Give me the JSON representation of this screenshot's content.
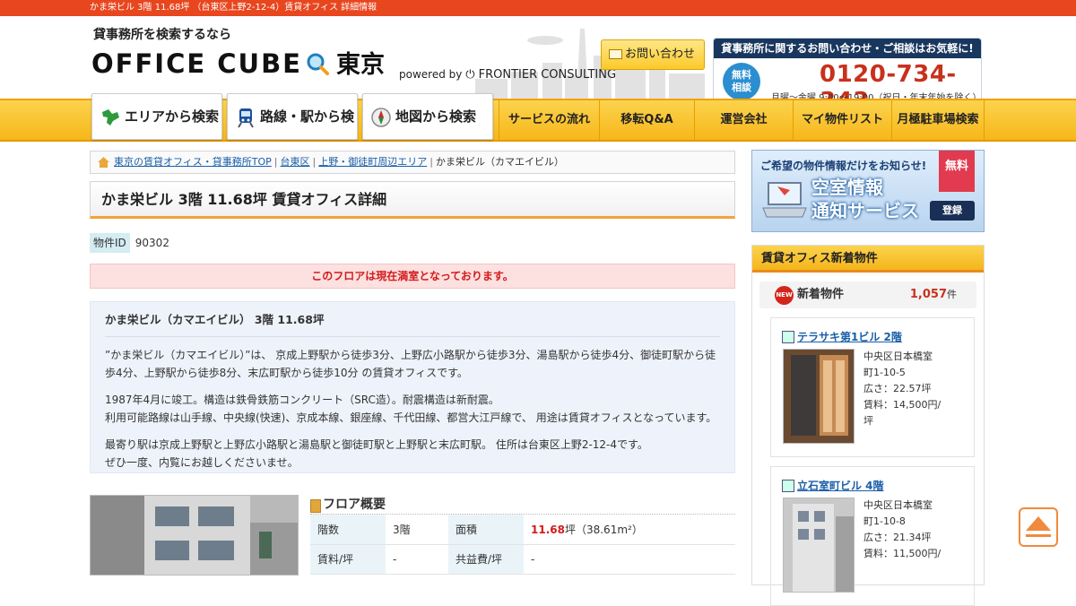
{
  "topbar": {
    "text": "かま栄ビル 3階 11.68坪 （台東区上野2-12-4）賃貸オフィス 詳細情報"
  },
  "header": {
    "tagline": "貸事務所を検索するなら",
    "logo_main": "OFFICE CUBE",
    "logo_city": "東京",
    "powered_by": "powered by",
    "company": "FRONTIER CONSULTING",
    "inquiry_button": "お問い合わせ",
    "contact_heading": "貸事務所に関するお問い合わせ・ご相談はお気軽に!",
    "free_badge_line1": "無料",
    "free_badge_line2": "相談",
    "phone": "0120-734-343",
    "hours": "月曜〜金曜 9:00〜19:00（祝日・年末年始を除く）"
  },
  "nav": {
    "area": "エリアから検索",
    "route": "路線・駅から検索",
    "map": "地図から検索",
    "items": [
      "サービスの流れ",
      "移転Q&A",
      "運営会社",
      "マイ物件リスト",
      "月極駐車場検索"
    ]
  },
  "breadcrumb": {
    "items": [
      "東京の賃貸オフィス・貸事務所TOP",
      "台東区",
      "上野・御徒町周辺エリア"
    ],
    "current": "かま栄ビル（カマエイビル）"
  },
  "main": {
    "title": "かま栄ビル 3階 11.68坪 賃貸オフィス詳細",
    "property_id_label": "物件ID",
    "property_id": "90302",
    "full_notice": "このフロアは現在満室となっております。",
    "desc_title": "かま栄ビル（カマエイビル） 3階 11.68坪",
    "desc_p1": "”かま栄ビル（カマエイビル）”は、 京成上野駅から徒歩3分、上野広小路駅から徒歩3分、湯島駅から徒歩4分、御徒町駅から徒歩4分、上野駅から徒歩8分、末広町駅から徒歩10分 の賃貸オフィスです。",
    "desc_p2a": "1987年4月に竣工。構造は鉄骨鉄筋コンクリート（SRC造）。耐震構造は新耐震。",
    "desc_p2b": "利用可能路線は山手線、中央線(快速)、京成本線、銀座線、千代田線、都営大江戸線で、 用途は賃貸オフィスとなっています。",
    "desc_p3a": "最寄り駅は京成上野駅と上野広小路駅と湯島駅と御徒町駅と上野駅と末広町駅。 住所は台東区上野2-12-4です。",
    "desc_p3b": "ぜひ一度、内覧にお越しくださいませ。"
  },
  "floor": {
    "heading": "フロア概要",
    "floors_label": "階数",
    "floors": "3階",
    "area_label": "面積",
    "area_tsubo": "11.68",
    "area_rest": "坪（38.61m²）",
    "rent_label": "賃料/坪",
    "rent": "-",
    "common_label": "共益費/坪",
    "common": "-"
  },
  "sidebar": {
    "banner_top": "ご希望の物件情報だけをお知らせ!",
    "banner_line1": "空室情報",
    "banner_line2": "通知サービス",
    "banner_free": "無料",
    "banner_login": "登録",
    "new_heading": "賃貸オフィス新着物件",
    "new_badge": "NEW",
    "new_label": "新着物件",
    "new_count": "1,057",
    "new_unit": "件",
    "cards": [
      {
        "title": "テラサキ第1ビル 2階",
        "addr1": "中央区日本橋室",
        "addr2": "町1-10-5",
        "area": "広さ：22.57坪",
        "rent": "賃料：14,500円/",
        "rent2": "坪"
      },
      {
        "title": "立石室町ビル 4階",
        "addr1": "中央区日本橋室",
        "addr2": "町1-10-8",
        "area": "広さ：21.34坪",
        "rent": "賃料：11,500円/",
        "rent2": ""
      }
    ]
  }
}
